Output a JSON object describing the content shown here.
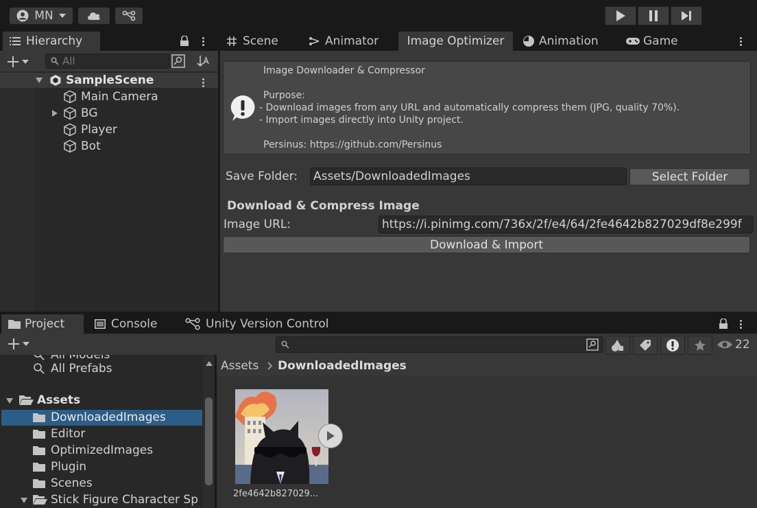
{
  "toolbar": {
    "account": "MN"
  },
  "hierarchy": {
    "tab": "Hierarchy",
    "search_placeholder": "All",
    "scene": "SampleScene",
    "objects": [
      "Main Camera",
      "BG",
      "Player",
      "Bot"
    ]
  },
  "editor_tabs": [
    "Scene",
    "Animator",
    "Image Optimizer",
    "Animation",
    "Game"
  ],
  "image_optimizer": {
    "help_box": {
      "title": "Image Downloader & Compressor",
      "purpose_label": "Purpose:",
      "line1": "- Download images from any URL and automatically compress them (JPG, quality 70%).",
      "line2": "- Import images directly into Unity project.",
      "credit": "Persinus: https://github.com/Persinus"
    },
    "save_folder_label": "Save Folder:",
    "save_folder_value": "Assets/DownloadedImages",
    "select_folder_button": "Select Folder",
    "section_title": "Download & Compress Image",
    "image_url_label": "Image URL:",
    "image_url_value": "https://i.pinimg.com/736x/2f/e4/64/2fe4642b827029df8e299f",
    "download_button": "Download & Import"
  },
  "bottom_tabs": [
    "Project",
    "Console",
    "Unity Version Control"
  ],
  "project": {
    "hidden_count": "22",
    "sidebar_items": {
      "all_models": "All Models",
      "all_prefabs": "All Prefabs",
      "assets": "Assets",
      "downloaded": "DownloadedImages",
      "editor": "Editor",
      "optimized": "OptimizedImages",
      "plugin": "Plugin",
      "scenes": "Scenes",
      "stick": "Stick Figure Character Sp"
    },
    "breadcrumb": {
      "root": "Assets",
      "current": "DownloadedImages"
    },
    "asset_name": "2fe4642b827029..."
  }
}
